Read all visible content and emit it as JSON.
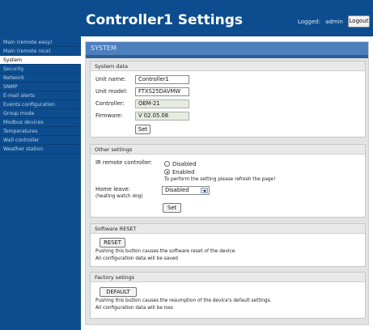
{
  "header": {
    "title": "Controller1 Settings",
    "logged_label": "Logged:",
    "user": "admin",
    "logout_label": "Logout"
  },
  "sidebar": {
    "items": [
      {
        "label": "Main (remote easy)",
        "active": false
      },
      {
        "label": "Main (remote nice)",
        "active": false
      },
      {
        "label": "System",
        "active": true
      },
      {
        "label": "Security",
        "active": false
      },
      {
        "label": "Network",
        "active": false
      },
      {
        "label": "SNMP",
        "active": false
      },
      {
        "label": "E-mail alerts",
        "active": false
      },
      {
        "label": "Events configuration",
        "active": false
      },
      {
        "label": "Group mode",
        "active": false
      },
      {
        "label": "Modbus devices",
        "active": false
      },
      {
        "label": "Temperatures",
        "active": false
      },
      {
        "label": "Wall controller",
        "active": false
      },
      {
        "label": "Weather station",
        "active": false
      }
    ]
  },
  "main": {
    "section_title": "SYSTEM",
    "system_data": {
      "title": "System data",
      "unit_name_label": "Unit name:",
      "unit_name_value": "Controller1",
      "unit_model_label": "Unit model:",
      "unit_model_value": "FTXS25DAVMW",
      "controller_label": "Controller:",
      "controller_value": "OEM-21",
      "firmware_label": "Firmware:",
      "firmware_value": "V 02.05.08",
      "set_label": "Set"
    },
    "other_settings": {
      "title": "Other settings",
      "ir_label": "IR remote controller:",
      "ir_option_disabled": "Disabled",
      "ir_option_enabled": "Enabled",
      "ir_selected": "Enabled",
      "refresh_note": "To perform the setting please refresh the page!",
      "home_leave_label": "Home leave:",
      "home_leave_sublabel": "(heating watch dog)",
      "home_leave_value": "Disabled",
      "set_label": "Set"
    },
    "software_reset": {
      "title": "Software RESET",
      "button_label": "RESET",
      "desc_line1": "Pushing this button causes the software reset of the device.",
      "desc_line2": "All configuration data will be saved"
    },
    "factory": {
      "title": "Factory setings",
      "button_label": "DEFAULT",
      "desc_line1": "Pushing this button causes the resumption of the device's default settings.",
      "desc_line2": "All configuration data will be loss"
    }
  },
  "colors": {
    "nav_background": "#0d4d8f",
    "section_header": "#4d7fbd",
    "content_background": "#e3e3e3"
  }
}
